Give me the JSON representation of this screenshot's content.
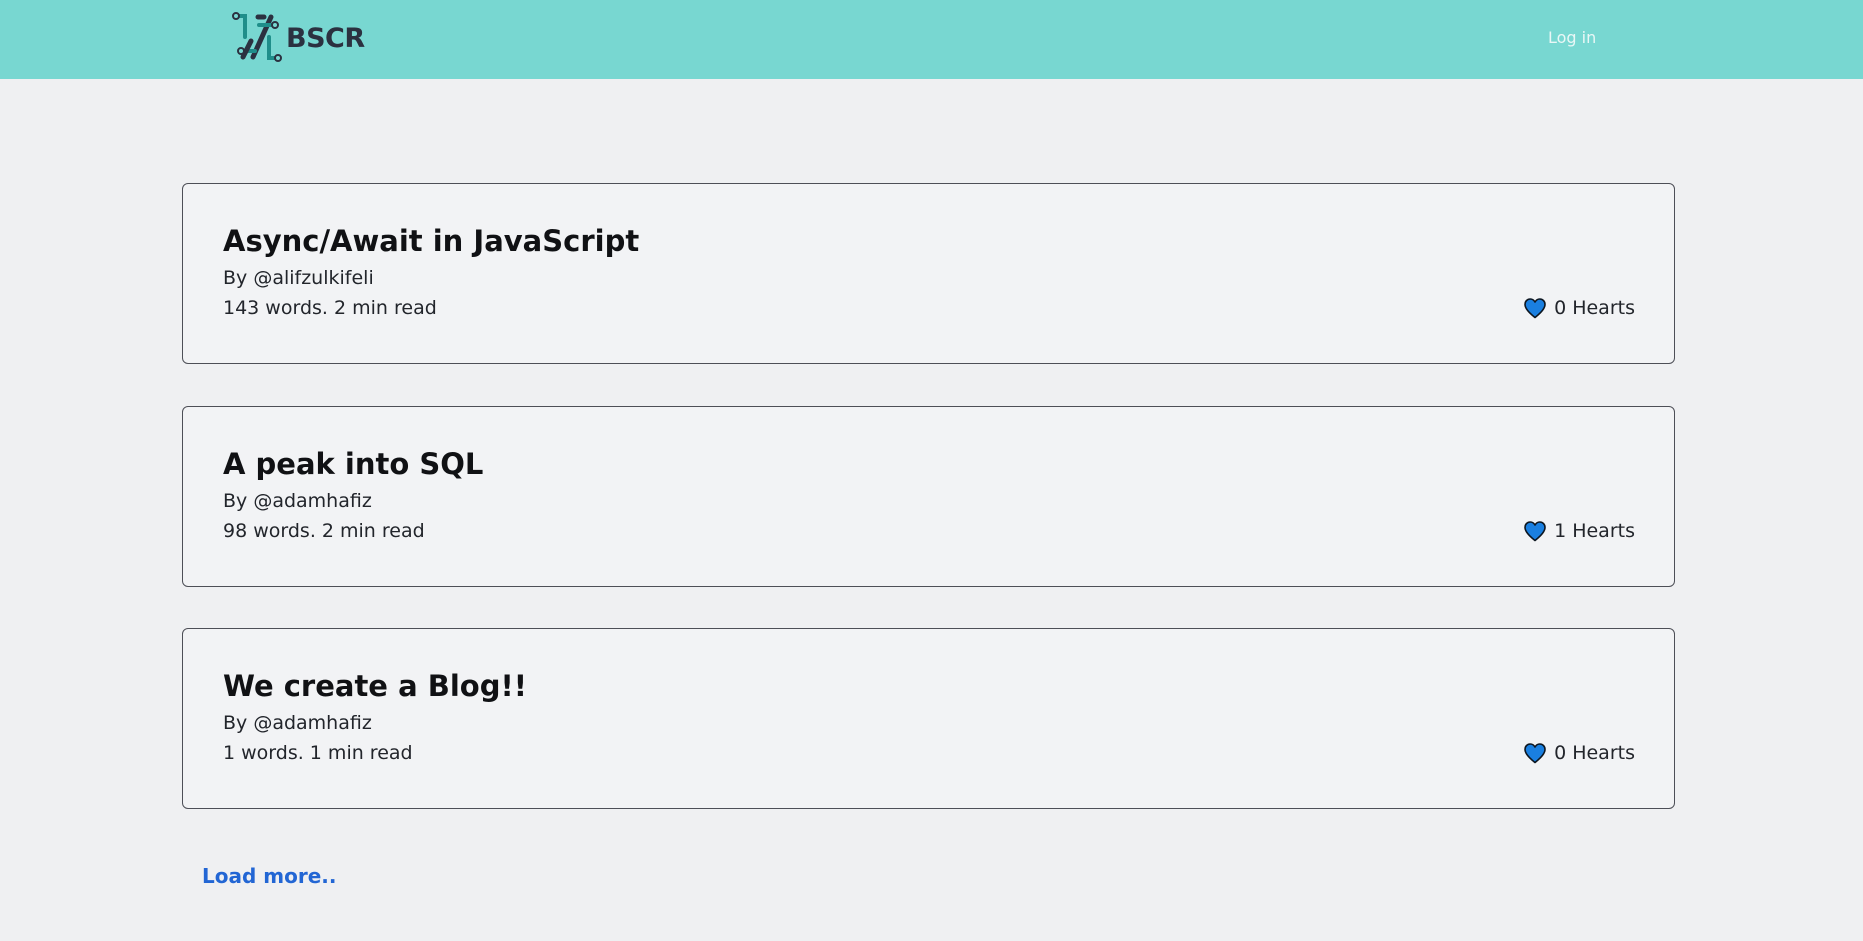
{
  "header": {
    "logo_text": "BSCR",
    "login_label": "Log in",
    "background_color": "#78d7d1"
  },
  "posts": [
    {
      "title": "Async/Await in JavaScript",
      "author": "By @alifzulkifeli",
      "meta": "143 words. 2 min read",
      "hearts": "0 Hearts"
    },
    {
      "title": "A peak into SQL",
      "author": "By @adamhafiz",
      "meta": "98 words. 2 min read",
      "hearts": "1 Hearts"
    },
    {
      "title": "We create a Blog!!",
      "author": "By @adamhafiz",
      "meta": "1 words. 1 min read",
      "hearts": "0 Hearts"
    }
  ],
  "load_more_label": "Load more..",
  "colors": {
    "accent": "#2266d4",
    "heart_fill": "#1a7fe0"
  }
}
